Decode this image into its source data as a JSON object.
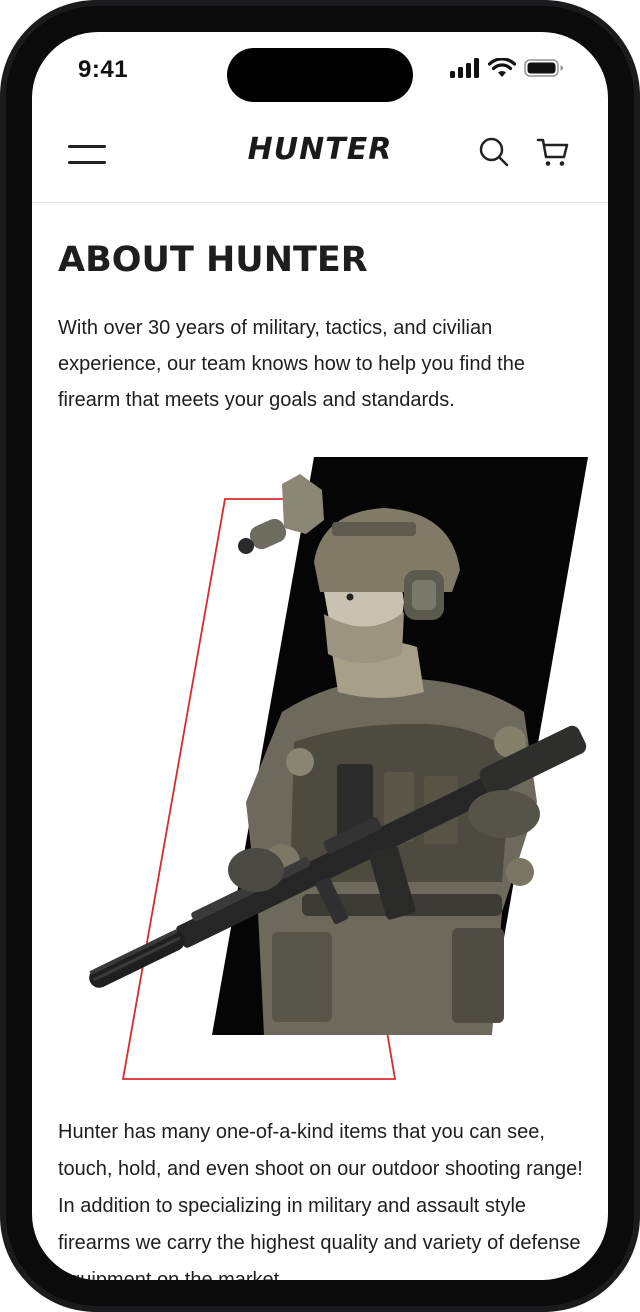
{
  "status_bar": {
    "time": "9:41"
  },
  "header": {
    "logo_text": "HUNTER",
    "menu_icon": "hamburger-menu-icon",
    "search_icon": "search-icon",
    "cart_icon": "cart-icon"
  },
  "about": {
    "title": "ABOUT HUNTER",
    "intro": "With over 30 years of military, tactics, and civilian experience, our team knows how to help you find the firearm that meets your goals and standards.",
    "body": "Hunter has many one-of-a-kind items that you can see, touch, hold, and even shoot on our outdoor shooting range! In addition to specializing in military and assault style firearms we carry the highest quality and variety of defense equipment on the market."
  },
  "colors": {
    "accent": "#d62b2b",
    "text": "#1e1e1e",
    "background": "#ffffff",
    "hero_background": "#050505"
  }
}
